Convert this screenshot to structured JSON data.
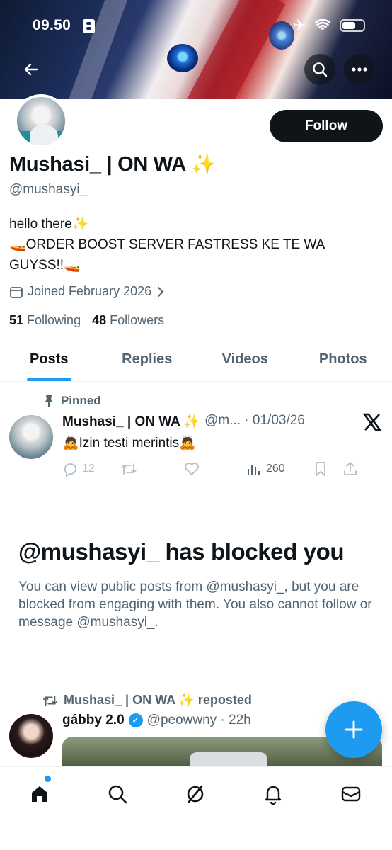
{
  "status_bar": {
    "time": "09.50"
  },
  "profile": {
    "display_name": "Mushasi_ | ON WA ✨",
    "handle": "@mushasyi_",
    "bio_line1": "hello there✨",
    "bio_line2": "🚤ORDER BOOST SERVER FASTRESS KE TE WA GUYSS!!🚤",
    "joined": "Joined February 2026",
    "following_count": "51",
    "following_label": "Following",
    "followers_count": "48",
    "followers_label": "Followers",
    "follow_button": "Follow"
  },
  "tabs": [
    {
      "label": "Posts",
      "active": true
    },
    {
      "label": "Replies",
      "active": false
    },
    {
      "label": "Videos",
      "active": false
    },
    {
      "label": "Photos",
      "active": false
    }
  ],
  "pinned_tweet": {
    "pinned_label": "Pinned",
    "author_name": "Mushasi_ | ON WA ✨",
    "author_handle_date": "@m... · 01/03/26",
    "text": "🙇Izin testi merintis🙇",
    "reply_count": "12",
    "views": "260"
  },
  "blocked_notice": {
    "title": "@mushasyi_ has blocked you",
    "body": "You can view public posts from @mushasyi_, but you are blocked from engaging with them. You also cannot follow or message @mushasyi_."
  },
  "repost": {
    "label": "Mushasi_ | ON WA ✨ reposted",
    "author_name": "gábby 2.0",
    "author_handle_time": "@peowwny · 22h"
  },
  "colors": {
    "accent": "#1d9bf0",
    "text_primary": "#0f1419",
    "text_secondary": "#536471",
    "divider": "#eff3f4"
  },
  "icons": [
    "back-arrow-icon",
    "search-icon",
    "more-icon",
    "calendar-icon",
    "chevron-right-icon",
    "pin-icon",
    "x-logo-icon",
    "reply-icon",
    "retweet-icon",
    "like-icon",
    "views-icon",
    "bookmark-icon",
    "share-icon",
    "verified-icon",
    "compose-plus-icon",
    "home-icon",
    "explore-icon",
    "grok-icon",
    "notifications-icon",
    "messages-icon"
  ]
}
